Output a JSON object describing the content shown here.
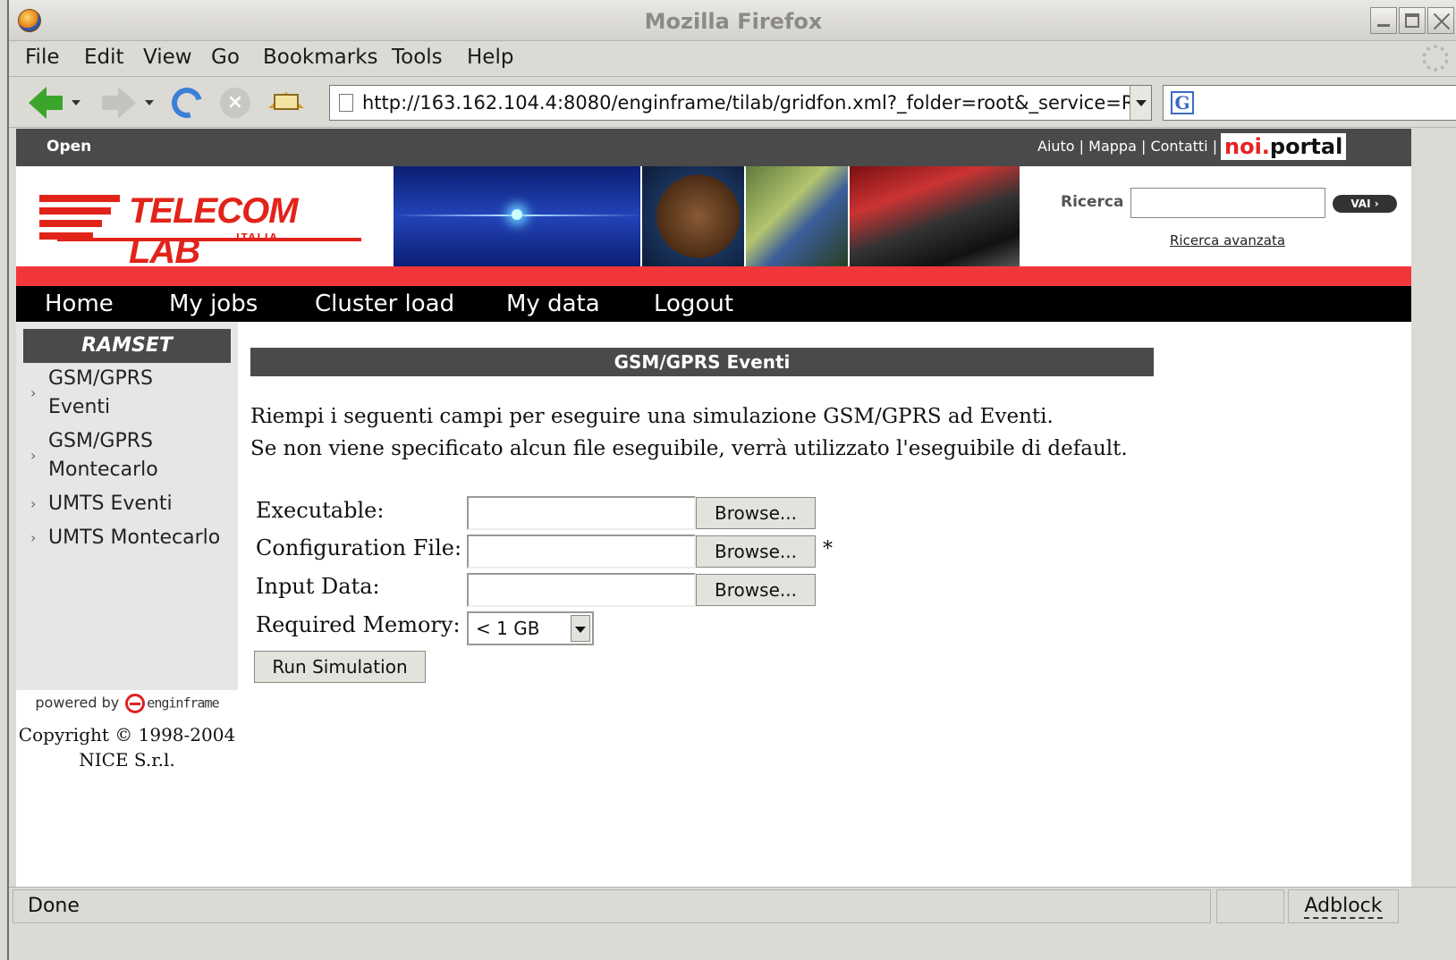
{
  "window": {
    "title": "Mozilla Firefox"
  },
  "menubar": {
    "items": [
      "File",
      "Edit",
      "View",
      "Go",
      "Bookmarks",
      "Tools",
      "Help"
    ]
  },
  "navbar": {
    "url": "http://163.162.104.4:8080/enginframe/tilab/gridfon.xml?_folder=root&_service=R",
    "search_icon": "G"
  },
  "site": {
    "top_left": "Open",
    "top_links": "Aiuto | Mappa | Contatti |",
    "noi": "noi.",
    "portal": "portal",
    "logo_brand": "TELECOM LAB",
    "logo_sub": "ITALIA",
    "search_label": "Ricerca",
    "search_button": "VAI ›",
    "advanced_search": "Ricerca avanzata",
    "nav": [
      "Home",
      "My jobs",
      "Cluster load",
      "My data",
      "Logout"
    ]
  },
  "sidebar": {
    "title": "RAMSET",
    "items": [
      {
        "line1": "GSM/GPRS",
        "line2": "Eventi"
      },
      {
        "line1": "GSM/GPRS",
        "line2": "Montecarlo"
      },
      {
        "line1": "UMTS Eventi",
        "line2": ""
      },
      {
        "line1": "UMTS Montecarlo",
        "line2": ""
      }
    ],
    "powered_by": "powered by",
    "powered_logo_text": "enginframe",
    "copyright_line1": "Copyright © 1998-2004",
    "copyright_line2": "NICE S.r.l."
  },
  "main": {
    "section_title": "GSM/GPRS Eventi",
    "intro_line1": "Riempi i seguenti campi per eseguire una simulazione GSM/GPRS ad Eventi.",
    "intro_line2": "Se non viene specificato alcun file eseguibile, verrà utilizzato l'eseguibile di default.",
    "fields": {
      "executable_label": "Executable:",
      "executable_value": "",
      "config_label": "Configuration File:",
      "config_value": "",
      "config_required_mark": "*",
      "input_label": "Input Data:",
      "input_value": "",
      "browse_label": "Browse...",
      "memory_label": "Required Memory:",
      "memory_value": "< 1 GB"
    },
    "run_button": "Run Simulation"
  },
  "statusbar": {
    "status": "Done",
    "adblock": "Adblock"
  },
  "colors": {
    "accent_red": "#e2231a",
    "strip_red": "#f2373b",
    "dark_gray": "#4a4a4a",
    "back_arrow_green": "#3aa52a"
  }
}
